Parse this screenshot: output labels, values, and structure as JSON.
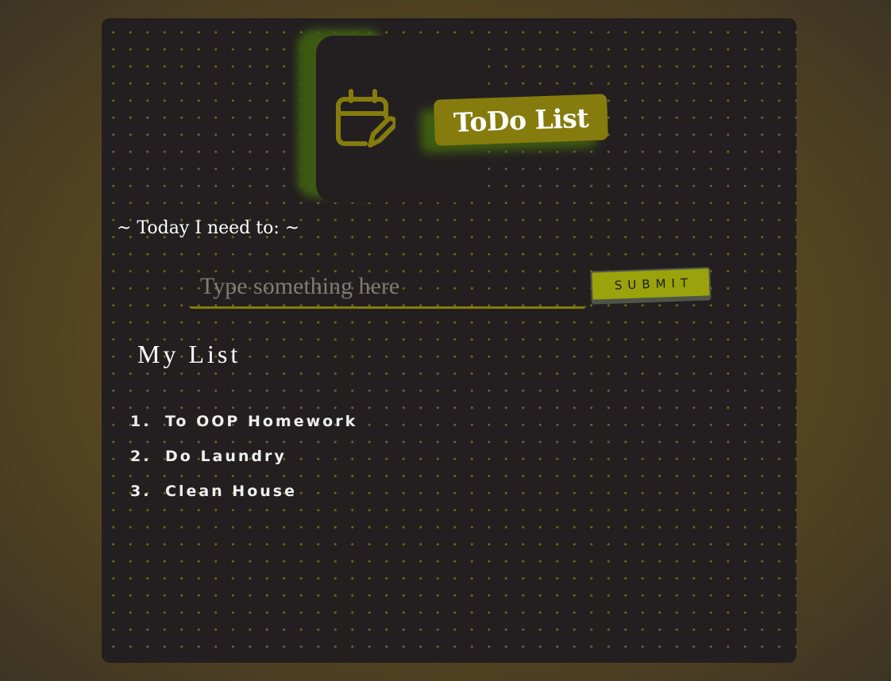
{
  "header": {
    "logo_icon": "calendar-edit-icon",
    "title": "ToDo List"
  },
  "prompt": "~ Today I need to: ~",
  "input": {
    "value": "",
    "placeholder": "Type something here"
  },
  "submit_label": "SUBMIT",
  "list": {
    "title": "My List",
    "items": [
      {
        "number": "1.",
        "text": "To OOP Homework"
      },
      {
        "number": "2.",
        "text": "Do Laundry"
      },
      {
        "number": "3.",
        "text": "Clean House"
      }
    ]
  },
  "colors": {
    "card_background": "#231f20",
    "accent": "#857c0d",
    "submit_background": "#9aa20c",
    "glow": "#3c5a12",
    "dot": "#6d6624"
  }
}
